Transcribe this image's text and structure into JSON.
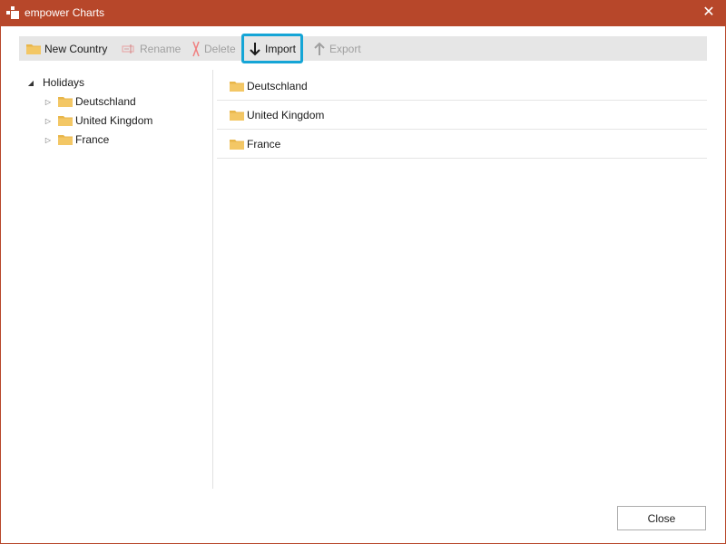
{
  "window": {
    "title": "empower Charts",
    "accent": "#b7472a"
  },
  "toolbar": {
    "new_country": "New Country",
    "rename": "Rename",
    "delete": "Delete",
    "import": "Import",
    "export": "Export",
    "highlight_color": "#15a5d6"
  },
  "tree": {
    "root": "Holidays",
    "children": [
      "Deutschland",
      "United Kingdom",
      "France"
    ]
  },
  "list": {
    "items": [
      "Deutschland",
      "United Kingdom",
      "France"
    ]
  },
  "footer": {
    "close": "Close"
  }
}
